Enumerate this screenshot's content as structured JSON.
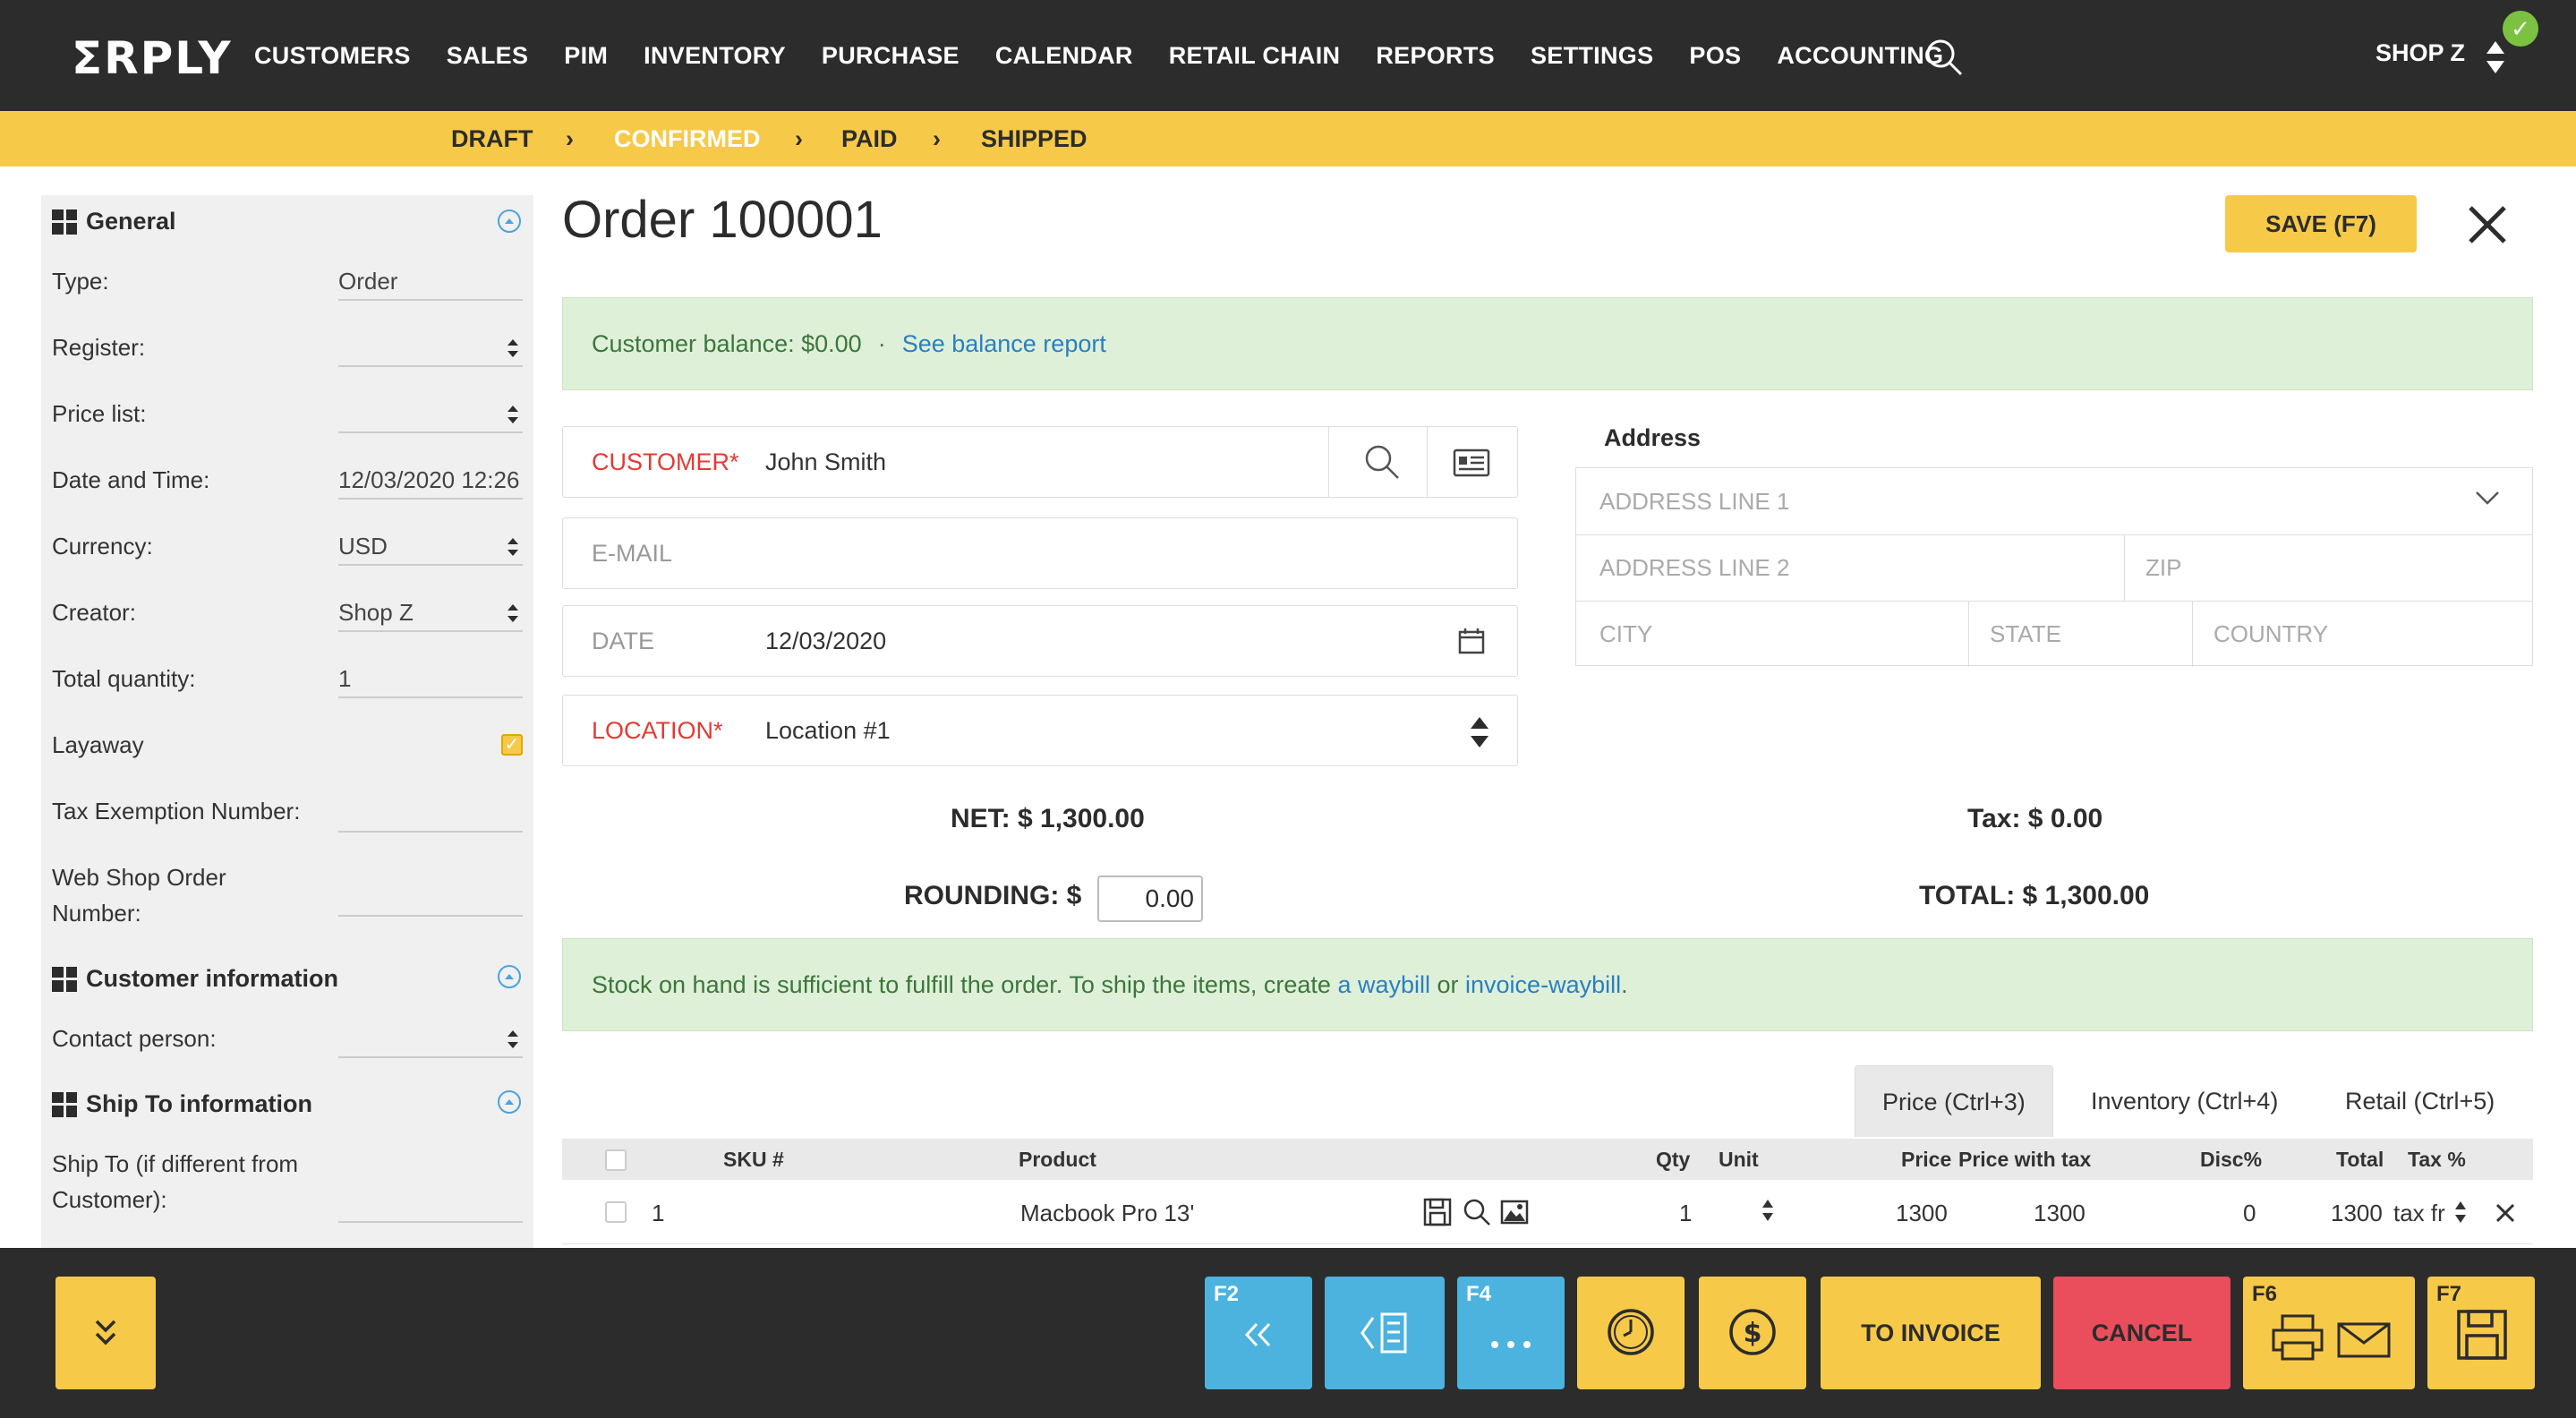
{
  "nav": {
    "logo": "ΣRPLY",
    "items": [
      "CUSTOMERS",
      "SALES",
      "PIM",
      "INVENTORY",
      "PURCHASE",
      "CALENDAR",
      "RETAIL CHAIN",
      "REPORTS",
      "SETTINGS",
      "POS",
      "ACCOUNTING"
    ],
    "shop": "SHOP Z",
    "check": "✓"
  },
  "status": {
    "steps": [
      "DRAFT",
      "CONFIRMED",
      "PAID",
      "SHIPPED"
    ],
    "active": "CONFIRMED",
    "separator": "›"
  },
  "general": {
    "title": "General",
    "fields": [
      {
        "label": "Type:",
        "value": "Order"
      },
      {
        "label": "Register:",
        "value": ""
      },
      {
        "label": "Price list:",
        "value": ""
      },
      {
        "label": "Date and Time:",
        "value": "12/03/2020 12:26"
      },
      {
        "label": "Currency:",
        "value": "USD"
      },
      {
        "label": "Creator:",
        "value": "Shop Z"
      },
      {
        "label": "Total quantity:",
        "value": "1"
      },
      {
        "label": "Layaway",
        "value": ""
      },
      {
        "label": "Tax Exemption Number:",
        "value": ""
      },
      {
        "label": "Web Shop Order Number:",
        "value": ""
      }
    ]
  },
  "customer_info": {
    "title": "Customer information",
    "contact_label": "Contact person:"
  },
  "ship_to": {
    "title": "Ship To information",
    "label": "Ship To (if different from Customer):"
  },
  "order": {
    "title": "Order 100001",
    "save_label": "SAVE (F7)"
  },
  "balance_alert": {
    "text": "Customer balance: $0.00",
    "dot": "·",
    "link": "See balance report"
  },
  "form": {
    "customer_label": "CUSTOMER*",
    "customer_value": "John Smith",
    "email_label": "E-MAIL",
    "date_label": "DATE",
    "date_value": "12/03/2020",
    "location_label": "LOCATION*",
    "location_value": "Location #1"
  },
  "address": {
    "title": "Address",
    "line1": "ADDRESS LINE 1",
    "line2": "ADDRESS LINE 2",
    "zip": "ZIP",
    "city": "CITY",
    "state": "STATE",
    "country": "COUNTRY"
  },
  "totals": {
    "net": "NET: $ 1,300.00",
    "tax": "Tax: $ 0.00",
    "rounding_label": "ROUNDING: $",
    "rounding_value": "0.00",
    "total": "TOTAL: $ 1,300.00"
  },
  "stock_alert": {
    "text": "Stock on hand is sufficient to fulfill the order. To ship the items, create ",
    "link1": "a waybill",
    "or": " or ",
    "link2": "invoice-waybill",
    "end": "."
  },
  "tabs": [
    "Price (Ctrl+3)",
    "Inventory (Ctrl+4)",
    "Retail (Ctrl+5)"
  ],
  "table": {
    "headers": [
      "SKU #",
      "Product",
      "Qty",
      "Unit",
      "Price",
      "Price with tax",
      "Disc%",
      "Total",
      "Tax %"
    ],
    "rows": [
      {
        "num": "1",
        "product": "Macbook Pro 13'",
        "qty": "1",
        "price": "1300",
        "price_tax": "1300",
        "disc": "0",
        "total": "1300",
        "tax": "tax fr"
      }
    ]
  },
  "toolbar": {
    "f2": "F2",
    "f4": "F4",
    "f6": "F6",
    "f7": "F7",
    "to_invoice": "TO INVOICE",
    "cancel": "CANCEL"
  },
  "colors": {
    "accent": "#f7c948",
    "dark": "#2c2c2c",
    "blue": "#4bb3de",
    "red": "#ea4d5b",
    "success_bg": "#dff0d8"
  }
}
